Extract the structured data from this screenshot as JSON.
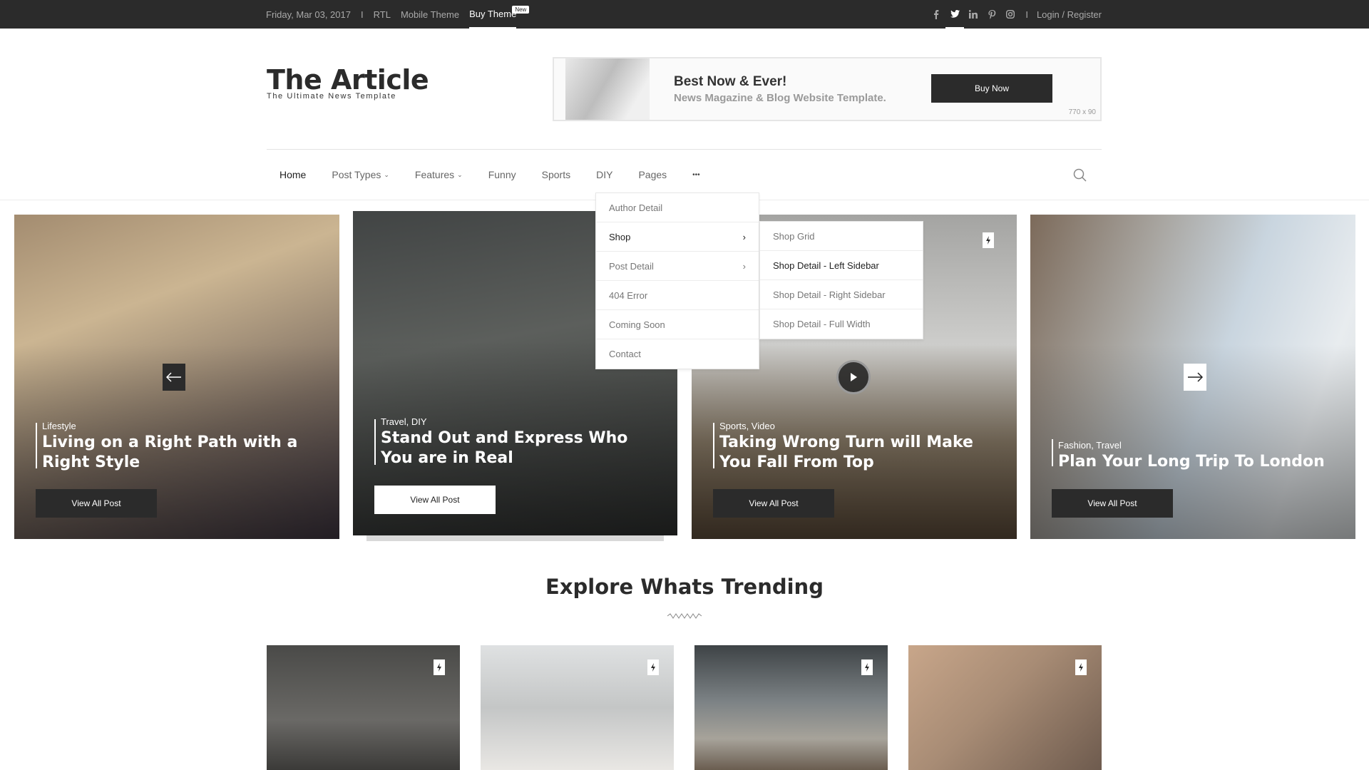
{
  "topbar": {
    "date": "Friday, Mar 03, 2017",
    "sep": "I",
    "links": [
      "RTL",
      "Mobile Theme"
    ],
    "buy_theme": "Buy Theme",
    "new_badge": "New",
    "social_icons": [
      "facebook-icon",
      "twitter-icon",
      "linkedin-icon",
      "pinterest-icon",
      "instagram-icon"
    ],
    "login": "Login / Register"
  },
  "header": {
    "logo_title": "The Article",
    "logo_subtitle": "The Ultimate News Template"
  },
  "ad": {
    "title": "Best Now & Ever!",
    "subtitle": "News Magazine & Blog Website Template.",
    "button": "Buy Now",
    "size_label": "770 x 90"
  },
  "nav": {
    "items": [
      "Home",
      "Post Types",
      "Features",
      "Funny",
      "Sports",
      "DIY",
      "Pages"
    ],
    "more_label": "•••"
  },
  "pages_menu": {
    "items": [
      "Author Detail",
      "Shop",
      "Post Detail",
      "404 Error",
      "Coming Soon",
      "Contact"
    ],
    "active": "Shop"
  },
  "shop_submenu": {
    "items": [
      "Shop Grid",
      "Shop Detail - Left Sidebar",
      "Shop Detail - Right Sidebar",
      "Shop Detail - Full Width"
    ],
    "active": "Shop Detail - Left Sidebar"
  },
  "slider": {
    "cards": [
      {
        "category": "Lifestyle",
        "title": "Living on a Right Path with a Right Style",
        "button": "View All Post"
      },
      {
        "category": "Travel, DIY",
        "title": "Stand Out and Express Who You are in Real",
        "button": "View All Post"
      },
      {
        "category": "Sports, Video",
        "title": "Taking Wrong Turn will Make You Fall From Top",
        "button": "View All Post"
      },
      {
        "category": "Fashion, Travel",
        "title": "Plan Your Long Trip To London",
        "button": "View All Post"
      }
    ]
  },
  "trending": {
    "title": "Explore Whats Trending"
  },
  "colors": {
    "dark": "#2b2b2b",
    "muted": "#a9a9a9",
    "border": "#e6e6e6"
  }
}
